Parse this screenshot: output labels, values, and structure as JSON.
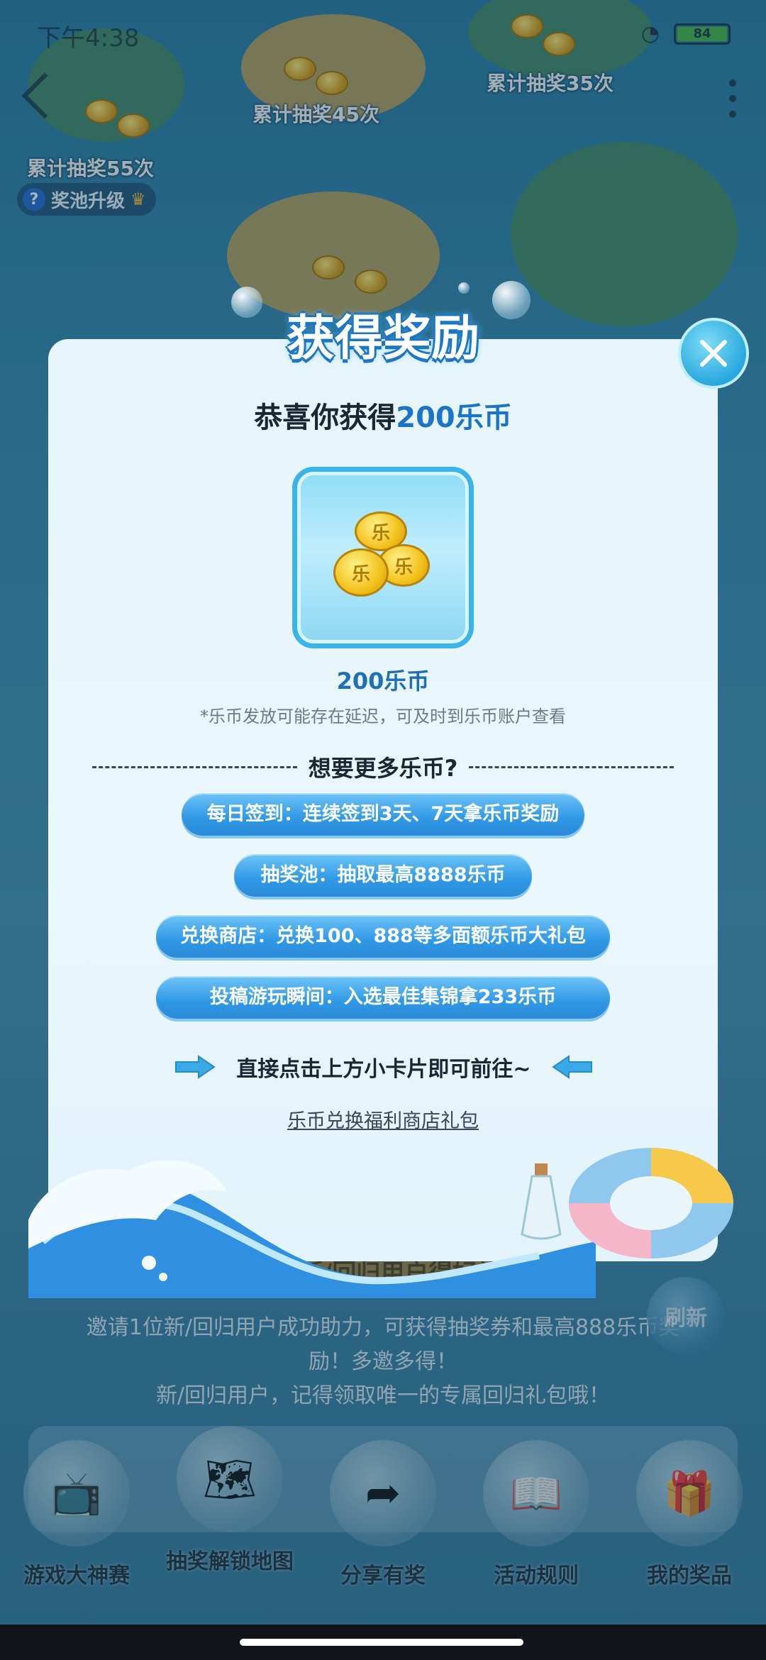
{
  "status_bar": {
    "time": "下午4:38",
    "battery": "84"
  },
  "background": {
    "labels": {
      "draws_55": "累计抽奖55次",
      "draws_45": "累计抽奖45次",
      "draws_35": "累计抽奖35次"
    },
    "pool_upgrade": "奖池升级",
    "invite_title": "邀请新/回归用户得好礼",
    "invite_text_line1": "邀请1位新/回归用户成功助力，可获得抽奖券和最高888乐币奖",
    "invite_text_line2": "励！多邀多得！",
    "invite_text_line3": "新/回归用户，记得领取唯一的专属回归礼包哦！",
    "refresh": "刷新",
    "bottom_nav": [
      {
        "label": "游戏大神赛",
        "icon": "tv-icon"
      },
      {
        "label": "抽奖解锁地图",
        "icon": "map-icon"
      },
      {
        "label": "分享有奖",
        "icon": "share-icon"
      },
      {
        "label": "活动规则",
        "icon": "book-icon"
      },
      {
        "label": "我的奖品",
        "icon": "gift-icon"
      }
    ]
  },
  "modal": {
    "title": "获得奖励",
    "congrats_prefix": "恭喜你获得",
    "congrats_amount": "200乐币",
    "reward_icon": "coins-icon",
    "reward_name": "200乐币",
    "reward_note": "*乐币发放可能存在延迟，可及时到乐币账户查看",
    "more_title": "想要更多乐币?",
    "options": [
      "每日签到：连续签到3天、7天拿乐币奖励",
      "抽奖池：抽取最高8888乐币",
      "兑换商店：兑换100、888等多面额乐币大礼包",
      "投稿游玩瞬间：入选最佳集锦拿233乐币"
    ],
    "hint": "直接点击上方小卡片即可前往~",
    "exchange_link": "乐币兑换福利商店礼包"
  },
  "colors": {
    "accent": "#1c74c6",
    "pill": "#2f98e6",
    "modal_bg": "#e6f5fc"
  }
}
